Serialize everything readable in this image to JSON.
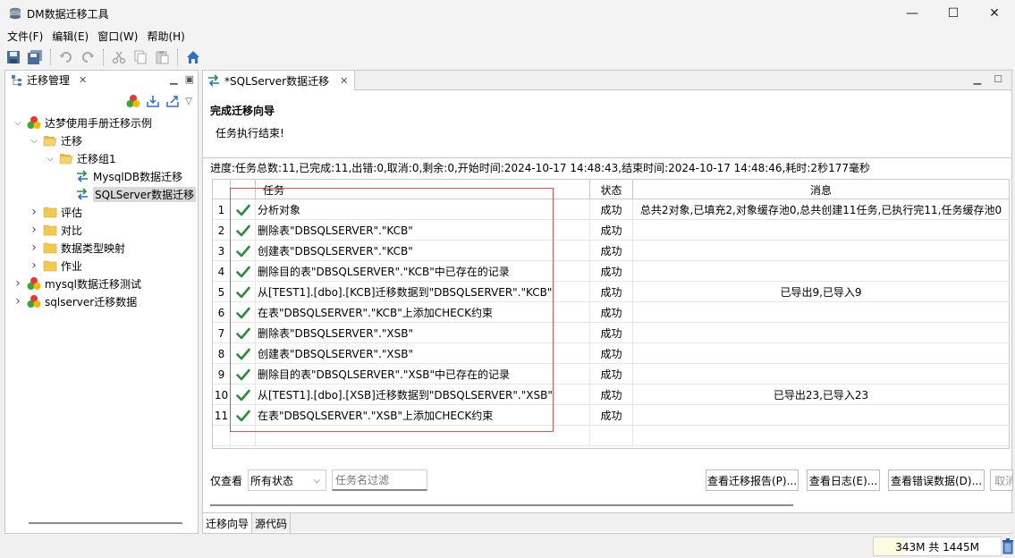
{
  "window": {
    "title": "DM数据迁移工具",
    "minimize": "—",
    "maximize": "☐",
    "close": "✕"
  },
  "menu": [
    "文件(F)",
    "编辑(E)",
    "窗口(W)",
    "帮助(H)"
  ],
  "left_panel": {
    "tab_label": "迁移管理",
    "tree": [
      {
        "label": "达梦使用手册迁移示例",
        "level": 0,
        "expanded": true,
        "icon": "project-icon"
      },
      {
        "label": "迁移",
        "level": 1,
        "expanded": true,
        "icon": "folder-open-icon"
      },
      {
        "label": "迁移组1",
        "level": 2,
        "expanded": true,
        "icon": "folder-open-icon"
      },
      {
        "label": "MysqlDB数据迁移",
        "level": 3,
        "icon": "migration-icon"
      },
      {
        "label": "SQLServer数据迁移",
        "level": 3,
        "icon": "migration-icon",
        "selected": true
      },
      {
        "label": "评估",
        "level": 1,
        "expanded": false,
        "icon": "folder-icon"
      },
      {
        "label": "对比",
        "level": 1,
        "expanded": false,
        "icon": "folder-icon"
      },
      {
        "label": "数据类型映射",
        "level": 1,
        "expanded": false,
        "icon": "folder-icon"
      },
      {
        "label": "作业",
        "level": 1,
        "expanded": false,
        "icon": "folder-icon"
      },
      {
        "label": "mysql数据迁移测试",
        "level": 0,
        "expanded": false,
        "icon": "project-icon"
      },
      {
        "label": "sqlserver迁移数据",
        "level": 0,
        "expanded": false,
        "icon": "project-icon"
      }
    ]
  },
  "editor": {
    "tab_label": "*SQLServer数据迁移",
    "wizard_title": "完成迁移向导",
    "wizard_message": "任务执行结束!",
    "progress": "进度:任务总数:11,已完成:11,出错:0,取消:0,剩余:0,开始时间:2024-10-17 14:48:43,结束时间:2024-10-17 14:48:46,耗时:2秒177毫秒",
    "columns": {
      "task": "任务",
      "status": "状态",
      "message": "消息"
    },
    "rows": [
      {
        "num": "1",
        "task": "分析对象",
        "status": "成功",
        "message": "总共2对象,已填充2,对象缓存池0,总共创建11任务,已执行完11,任务缓存池0"
      },
      {
        "num": "2",
        "task": "删除表\"DBSQLSERVER\".\"KCB\"",
        "status": "成功",
        "message": ""
      },
      {
        "num": "3",
        "task": "创建表\"DBSQLSERVER\".\"KCB\"",
        "status": "成功",
        "message": ""
      },
      {
        "num": "4",
        "task": "删除目的表\"DBSQLSERVER\".\"KCB\"中已存在的记录",
        "status": "成功",
        "message": ""
      },
      {
        "num": "5",
        "task": "从[TEST1].[dbo].[KCB]迁移数据到\"DBSQLSERVER\".\"KCB\"",
        "status": "成功",
        "message": "已导出9,已导入9"
      },
      {
        "num": "6",
        "task": "在表\"DBSQLSERVER\".\"KCB\"上添加CHECK约束",
        "status": "成功",
        "message": ""
      },
      {
        "num": "7",
        "task": "删除表\"DBSQLSERVER\".\"XSB\"",
        "status": "成功",
        "message": ""
      },
      {
        "num": "8",
        "task": "创建表\"DBSQLSERVER\".\"XSB\"",
        "status": "成功",
        "message": ""
      },
      {
        "num": "9",
        "task": "删除目的表\"DBSQLSERVER\".\"XSB\"中已存在的记录",
        "status": "成功",
        "message": ""
      },
      {
        "num": "10",
        "task": "从[TEST1].[dbo].[XSB]迁移数据到\"DBSQLSERVER\".\"XSB\"",
        "status": "成功",
        "message": "已导出23,已导入23"
      },
      {
        "num": "11",
        "task": "在表\"DBSQLSERVER\".\"XSB\"上添加CHECK约束",
        "status": "成功",
        "message": ""
      }
    ],
    "filter": {
      "label": "仅查看",
      "selected": "所有状态",
      "placeholder": "任务名过滤"
    },
    "buttons": {
      "report": "查看迁移报告(P)...",
      "log": "查看日志(E)...",
      "errors": "查看错误数据(D)...",
      "cancel": "取消"
    },
    "bottom_tabs": [
      "迁移向导",
      "源代码"
    ]
  },
  "status": {
    "memory": "343M 共 1445M",
    "memory_used_fraction": 0.237
  },
  "colors": {
    "success_check": "#2e8b3a",
    "highlight_border": "#d9534f",
    "toolbar_home": "#2a6fc9"
  }
}
